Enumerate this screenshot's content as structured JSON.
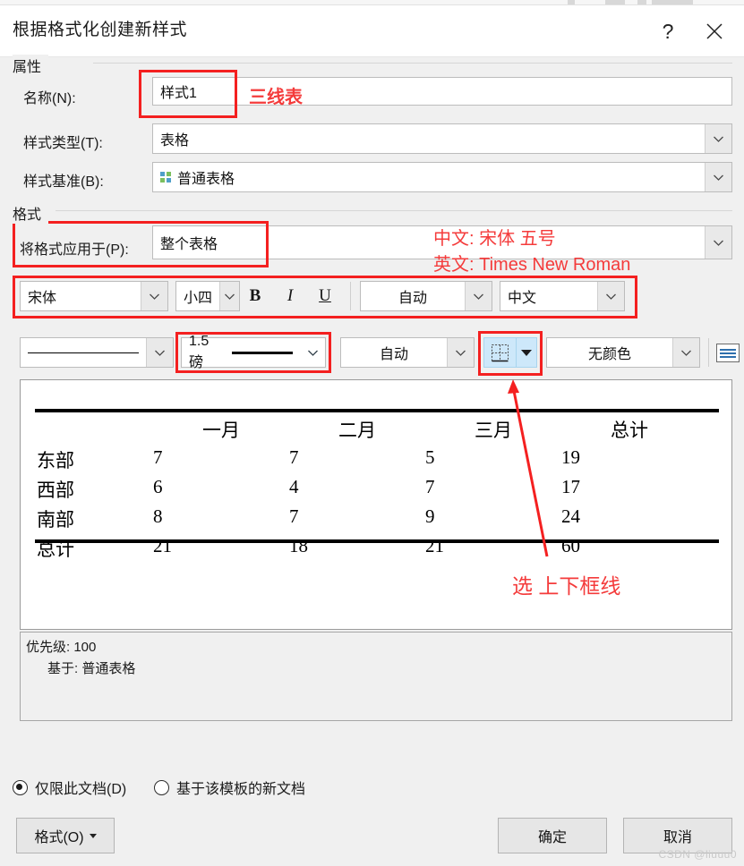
{
  "window": {
    "title": "根据格式化创建新样式",
    "help_label": "?",
    "close_label": "✕"
  },
  "groups": {
    "properties": "属性",
    "formatting": "格式"
  },
  "properties": {
    "name": {
      "label": "名称(N):",
      "value": "样式1"
    },
    "style_type": {
      "label": "样式类型(T):",
      "value": "表格"
    },
    "style_base": {
      "label": "样式基准(B):",
      "value": "普通表格",
      "icon": "table-grid-icon"
    }
  },
  "formatting": {
    "apply_to": {
      "label": "将格式应用于(P):",
      "value": "整个表格"
    },
    "font_family": {
      "value": "宋体"
    },
    "font_size": {
      "value": "小四"
    },
    "bold": "B",
    "italic": "I",
    "underline": "U",
    "font_color": {
      "value": "自动"
    },
    "language": {
      "value": "中文"
    },
    "border_line_style": {
      "value": ""
    },
    "border_width": {
      "value": "1.5 磅"
    },
    "border_color": {
      "value": "自动"
    },
    "borders_button": {
      "value": "borders-icon"
    },
    "shading_color": {
      "value": "无颜色"
    },
    "table_format_button": {
      "value": "table-properties-icon"
    }
  },
  "preview": {
    "columns": [
      "",
      "一月",
      "二月",
      "三月",
      "总计"
    ],
    "rows": [
      {
        "header": "东部",
        "values": [
          "7",
          "7",
          "5",
          "19"
        ]
      },
      {
        "header": "西部",
        "values": [
          "6",
          "4",
          "7",
          "17"
        ]
      },
      {
        "header": "南部",
        "values": [
          "8",
          "7",
          "9",
          "24"
        ]
      },
      {
        "header": "总计",
        "values": [
          "21",
          "18",
          "21",
          "60"
        ]
      }
    ]
  },
  "description": {
    "line1": "优先级: 100",
    "line2": "基于: 普通表格"
  },
  "scope": {
    "this_document": {
      "label": "仅限此文档(D)",
      "selected": true
    },
    "new_documents": {
      "label": "基于该模板的新文档",
      "selected": false
    }
  },
  "buttons": {
    "format": "格式(O)",
    "ok": "确定",
    "cancel": "取消"
  },
  "annotations": {
    "name_note": "三线表",
    "chinese_font_note": "中文: 宋体 五号",
    "english_font_note": "英文: Times New Roman",
    "border_note": "选 上下框线"
  },
  "watermark": "CSDN @liuuu0",
  "colors": {
    "accent_red": "#f42020",
    "annotation_red": "#f43b3b",
    "selection_blue": "#cde8fa",
    "dialog_bg": "#f0f0f0"
  }
}
